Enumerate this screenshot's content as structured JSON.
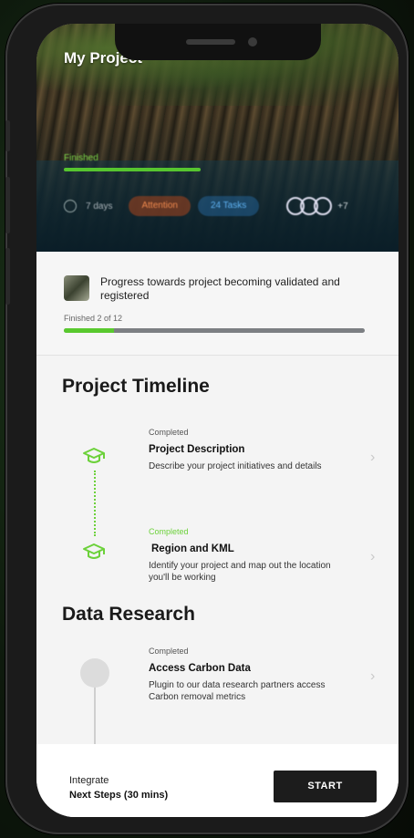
{
  "hero": {
    "title": "My Project",
    "status": "Finished",
    "progress": 1.0,
    "duration": "7 days",
    "badge_attention": "Attention",
    "badge_tasks": "24 Tasks",
    "extra_members": "+7"
  },
  "progress_card": {
    "text": "Progress towards project becoming validated and registered",
    "finished_label": "Finished 2 of 12",
    "completed": 2,
    "total": 12,
    "fill_color": "#59c92e"
  },
  "timeline": {
    "title": "Project Timeline",
    "steps": [
      {
        "status": "Completed",
        "name": "Project Description",
        "description": "Describe your project initiatives and details",
        "icon": "graduation-cap-icon"
      },
      {
        "status": "Completed",
        "name": "Region and KML",
        "description": "Identify your project and map out the location you'll be working",
        "icon": "graduation-cap-icon"
      }
    ]
  },
  "research": {
    "title": "Data Research",
    "steps": [
      {
        "status": "Completed",
        "name": "Access Carbon Data",
        "description": "Plugin to our data research partners access Carbon removal metrics"
      }
    ]
  },
  "footer": {
    "integrate": "Integrate",
    "next_steps": "Next Steps (30 mins)",
    "start_label": "START"
  },
  "colors": {
    "accent_green": "#6cd13a",
    "attention": "#f08a4e",
    "tasks": "#5fb2f2",
    "button_dark": "#1c1c1c"
  }
}
